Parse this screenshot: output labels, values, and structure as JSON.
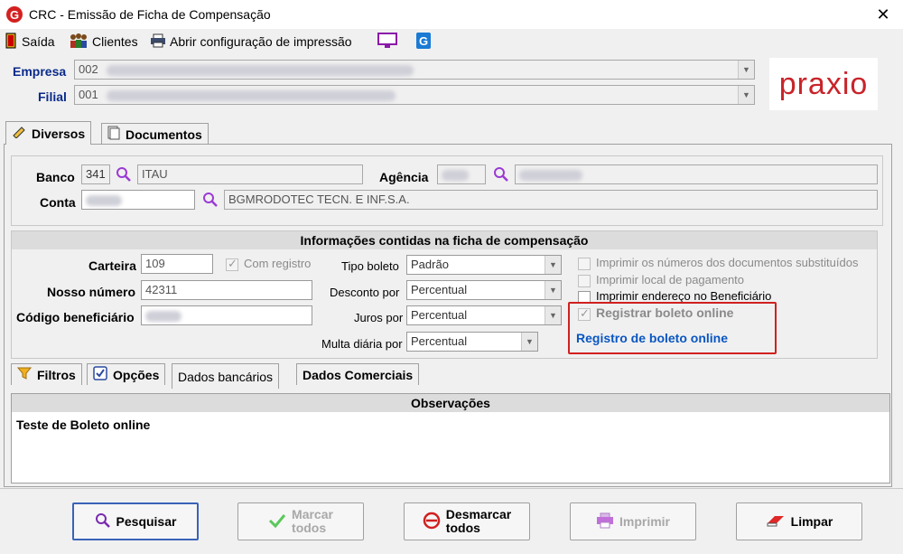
{
  "window": {
    "title": "CRC - Emissão de Ficha de Compensação"
  },
  "menu": {
    "exit": "Saída",
    "clients": "Clientes",
    "print_config": "Abrir configuração de impressão"
  },
  "header": {
    "company_label": "Empresa",
    "company_value": "002",
    "branch_label": "Filial",
    "branch_value": "001",
    "logo_text": "praxio"
  },
  "top_tabs": {
    "diversos": "Diversos",
    "documentos": "Documentos"
  },
  "bank": {
    "bank_label": "Banco",
    "bank_code": "341",
    "bank_name": "ITAU",
    "agency_label": "Agência",
    "account_label": "Conta",
    "account_holder": "BGMRODOTEC TECN. E INF.S.A."
  },
  "ficha": {
    "title": "Informações contidas na ficha de compensação",
    "carteira_label": "Carteira",
    "carteira_value": "109",
    "com_registro": "Com registro",
    "nosso_numero_label": "Nosso número",
    "nosso_numero_value": "42311",
    "codigo_benef_label": "Código beneficiário",
    "tipo_boleto_label": "Tipo boleto",
    "tipo_boleto_value": "Padrão",
    "desconto_label": "Desconto por",
    "desconto_value": "Percentual",
    "juros_label": "Juros por",
    "juros_value": "Percentual",
    "multa_label": "Multa diária por",
    "multa_value": "Percentual",
    "opt_substituidos": "Imprimir os números dos documentos substituídos",
    "opt_local": "Imprimir local de pagamento",
    "opt_endereco": "Imprimir endereço no Beneficiário",
    "opt_registrar": "Registrar boleto online",
    "link_registro": "Registro de boleto online"
  },
  "bottom_tabs": {
    "filtros": "Filtros",
    "opcoes": "Opções",
    "dados_bancarios": "Dados bancários",
    "dados_comerciais": "Dados Comerciais"
  },
  "observacoes": {
    "title": "Observações",
    "text": "Teste de Boleto online"
  },
  "buttons": {
    "pesquisar": "Pesquisar",
    "marcar_1": "Marcar",
    "marcar_2": "todos",
    "desmarcar_1": "Desmarcar",
    "desmarcar_2": "todos",
    "imprimir": "Imprimir",
    "limpar": "Limpar"
  },
  "colors": {
    "accent_blue": "#0a56c2",
    "highlight_red": "#d02020",
    "logo_red": "#c8242a"
  }
}
